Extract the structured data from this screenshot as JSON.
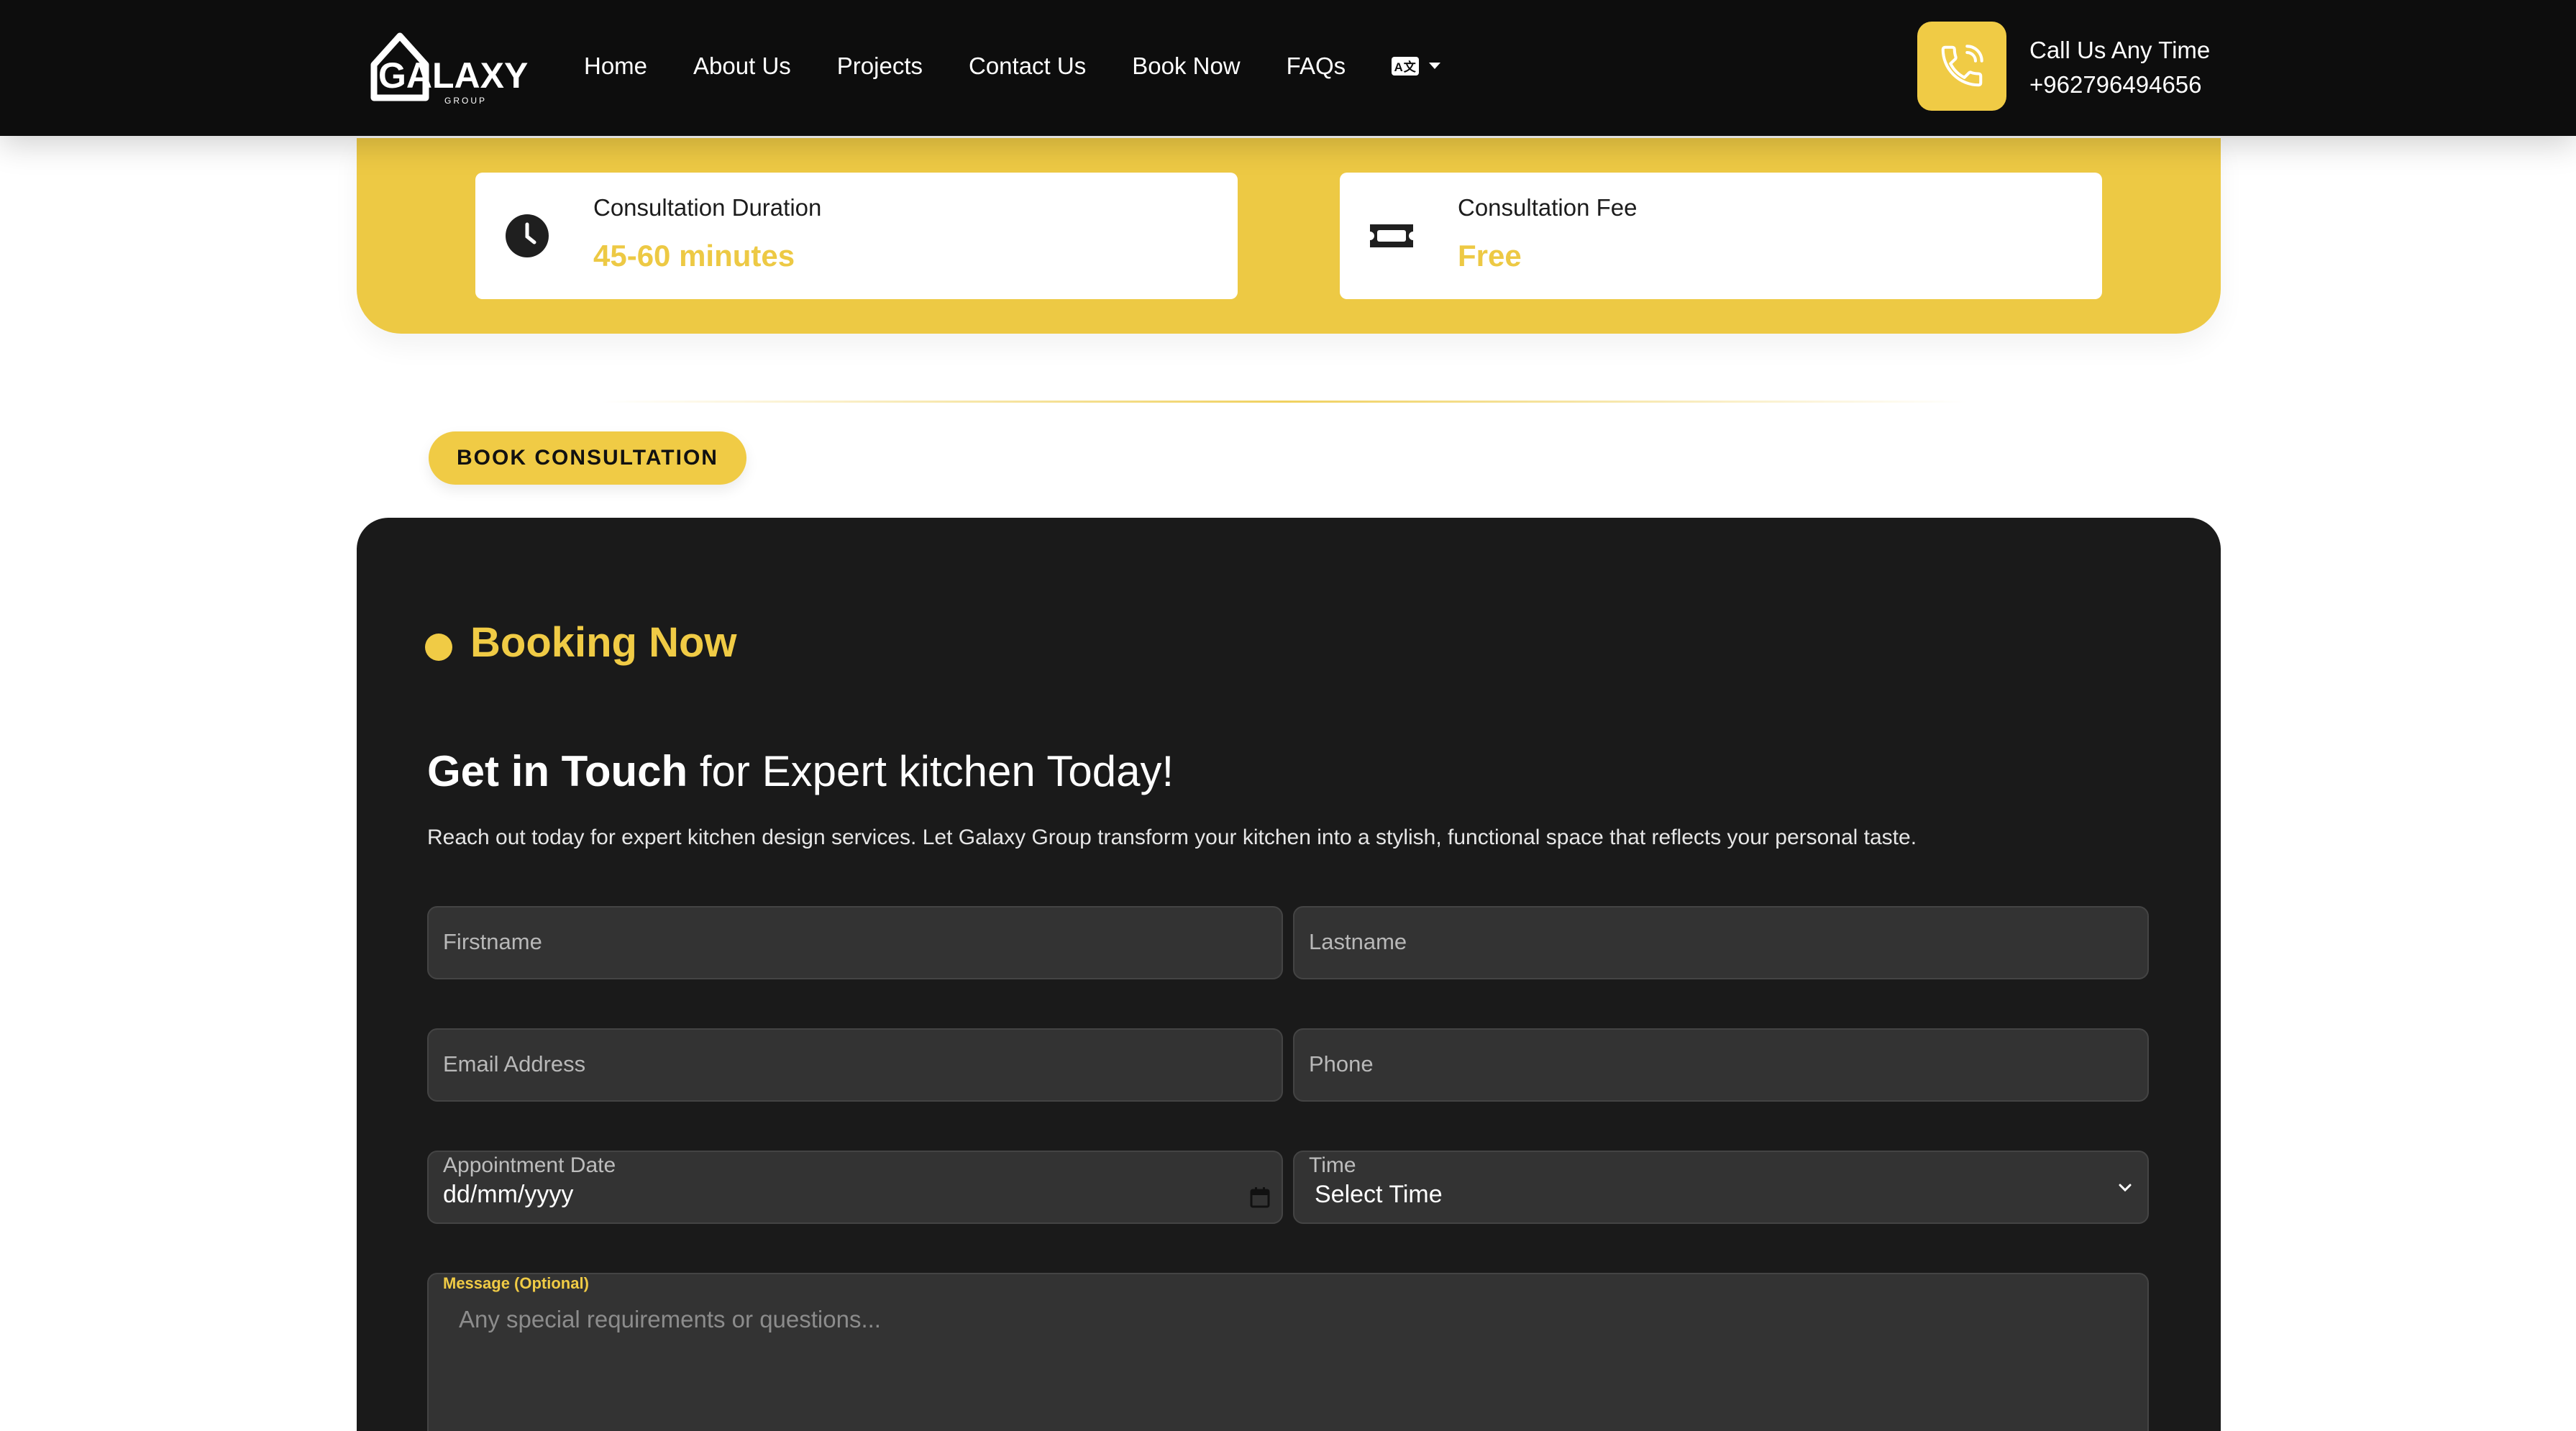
{
  "header": {
    "logo_text": "GALAXY",
    "logo_subtext": "GROUP",
    "nav": [
      "Home",
      "About Us",
      "Projects",
      "Contact Us",
      "Book Now",
      "FAQs"
    ],
    "language_icon": "translate-icon",
    "call_label": "Call Us Any Time",
    "call_number": "+962796494656"
  },
  "info": {
    "duration_label": "Consultation Duration",
    "duration_value": "45-60 minutes",
    "fee_label": "Consultation Fee",
    "fee_value": "Free"
  },
  "book_button": "BOOK CONSULTATION",
  "booking": {
    "section_title": "Booking Now",
    "headline_bold": "Get in Touch",
    "headline_rest": " for Expert kitchen Today!",
    "description": "Reach out today for expert kitchen design services. Let Galaxy Group transform your kitchen into a stylish, functional space that reflects your personal taste.",
    "firstname_placeholder": "Firstname",
    "lastname_placeholder": "Lastname",
    "email_placeholder": "Email Address",
    "phone_placeholder": "Phone",
    "date_label": "Appointment Date",
    "date_value": "dd/mm/yyyy",
    "time_label": "Time",
    "time_value": "Select Time",
    "message_label": "Message (Optional)",
    "message_placeholder": "Any special requirements or questions..."
  },
  "colors": {
    "accent": "#edc944",
    "header_bg": "#0d0d0d",
    "panel_bg": "#1a1a1a",
    "field_bg": "#333333"
  }
}
